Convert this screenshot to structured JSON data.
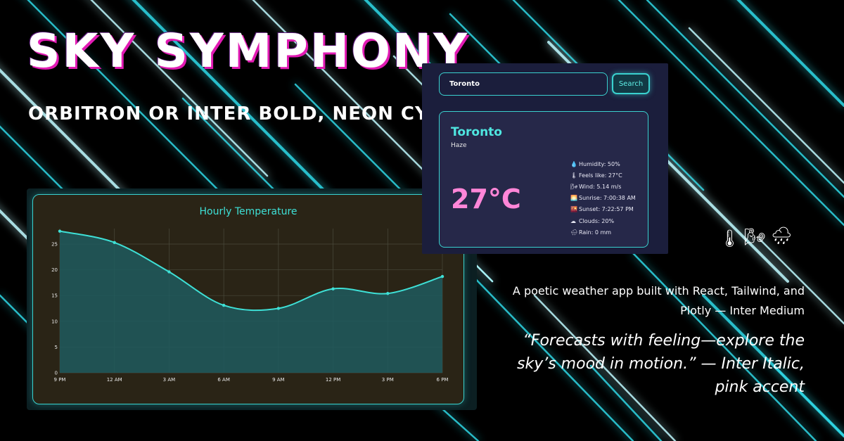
{
  "hero": {
    "title": "SKY SYMPHONY",
    "subtitle": "ORBITRON OR INTER BOLD, NEON CYAN"
  },
  "colors": {
    "accent_cyan": "#3ad1cf",
    "accent_pink": "#ff86d8",
    "title_shadow": "#e21bb4",
    "app_bg": "#1b1e3c",
    "chart_bg": "#2a2416"
  },
  "weather_app": {
    "search": {
      "value": "Toronto",
      "button_label": "Search"
    },
    "city": "Toronto",
    "condition": "Haze",
    "temperature": "27°C",
    "stats": [
      {
        "icon": "droplet-icon",
        "glyph": "💧",
        "label": "Humidity: 50%"
      },
      {
        "icon": "thermometer-icon",
        "glyph": "🌡",
        "label": "Feels like: 27°C"
      },
      {
        "icon": "wind-icon",
        "glyph": "🌬",
        "label": "Wind: 5.14 m/s"
      },
      {
        "icon": "sunrise-icon",
        "glyph": "🌅",
        "label": "Sunrise: 7:00:38 AM"
      },
      {
        "icon": "sunset-icon",
        "glyph": "🌇",
        "label": "Sunset: 7:22:57 PM"
      },
      {
        "icon": "cloud-icon",
        "glyph": "☁",
        "label": "Clouds: 20%"
      },
      {
        "icon": "rain-icon",
        "glyph": "🌧",
        "label": "Rain: 0 mm"
      }
    ]
  },
  "decor_icons": [
    {
      "name": "thermometer-icon",
      "glyph": "🌡"
    },
    {
      "name": "wind-face-icon",
      "glyph": "🌬"
    },
    {
      "name": "rain-cloud-icon",
      "glyph": "🌧"
    }
  ],
  "tagline": "A poetic weather app built with React, Tailwind, and Plotly — Inter Medium",
  "quote": "“Forecasts with feeling—explore the sky’s mood in motion.” — Inter Italic, pink accent",
  "chart_data": {
    "type": "area",
    "title": "Hourly Temperature",
    "x": [
      "9 PM",
      "12 AM",
      "3 AM",
      "6 AM",
      "9 AM",
      "12 PM",
      "3 PM",
      "6 PM"
    ],
    "values": [
      27.5,
      25.3,
      19.6,
      13.1,
      12.5,
      16.3,
      15.4,
      18.7
    ],
    "ylim": [
      0,
      28
    ],
    "yticks": [
      0,
      5,
      10,
      15,
      20,
      25
    ],
    "grid": true,
    "line_color": "#3ee0d6",
    "fill_color": "#1f5b5e"
  }
}
